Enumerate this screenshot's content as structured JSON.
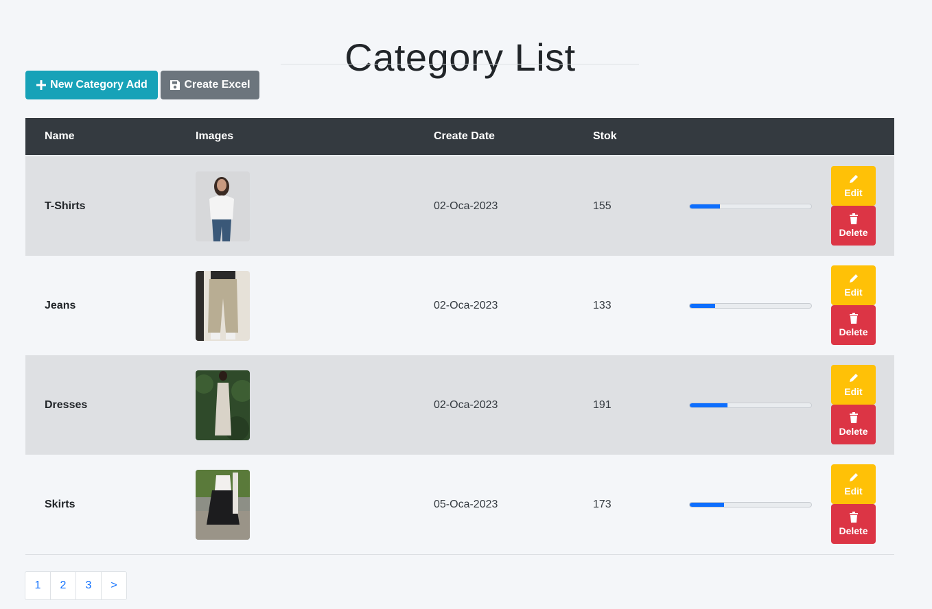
{
  "page": {
    "title": "Category List"
  },
  "toolbar": {
    "new_label": "New Category Add",
    "excel_label": "Create Excel",
    "new_color": "#17a2b8",
    "excel_color": "#6c757d"
  },
  "table": {
    "headers": {
      "name": "Name",
      "images": "Images",
      "create_date": "Create Date",
      "stok": "Stok"
    },
    "rows": [
      {
        "name": "T-Shirts",
        "date": "02-Oca-2023",
        "stok": "155",
        "progress": 0.25,
        "image": "woman in white t-shirt and jeans"
      },
      {
        "name": "Jeans",
        "date": "02-Oca-2023",
        "stok": "133",
        "progress": 0.21,
        "image": "beige cargo pants"
      },
      {
        "name": "Dresses",
        "date": "02-Oca-2023",
        "stok": "191",
        "progress": 0.31,
        "image": "satin slip dress"
      },
      {
        "name": "Skirts",
        "date": "05-Oca-2023",
        "stok": "173",
        "progress": 0.28,
        "image": "black ruffle mini skirt"
      }
    ],
    "edit_label": "Edit",
    "delete_label": "Delete",
    "edit_color": "#ffc107",
    "delete_color": "#dc3545",
    "progress_color": "#0d6efd"
  },
  "pagination": {
    "pages": [
      "1",
      "2",
      "3"
    ],
    "next": ">"
  }
}
